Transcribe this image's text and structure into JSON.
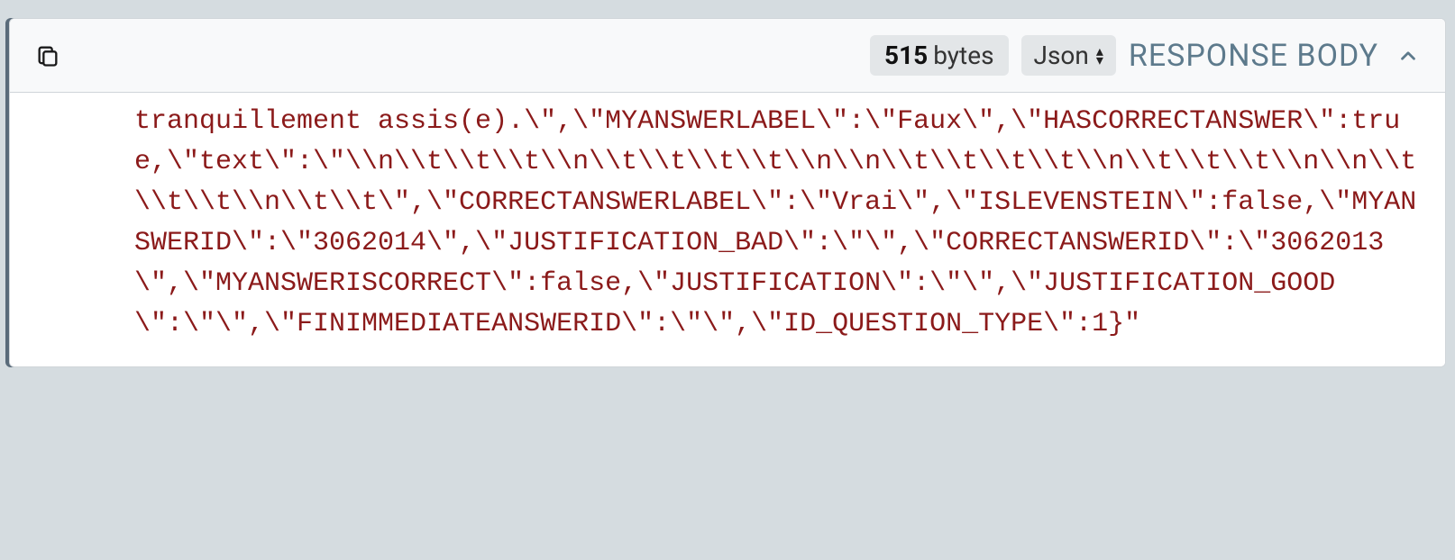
{
  "header": {
    "size_value": "515",
    "size_unit": "bytes",
    "format": "Json",
    "title": "RESPONSE BODY"
  },
  "body": {
    "text": "tranquillement assis(e).\\\",\\\"MYANSWERLABEL\\\":\\\"Faux\\\",\\\"HASCORRECTANSWER\\\":true,\\\"text\\\":\\\"\\\\n\\\\t\\\\t\\\\t\\\\n\\\\t\\\\t\\\\t\\\\t\\\\n\\\\n\\\\t\\\\t\\\\t\\\\t\\\\n\\\\t\\\\t\\\\t\\\\n\\\\n\\\\t\\\\t\\\\t\\\\n\\\\t\\\\t\\\",\\\"CORRECTANSWERLABEL\\\":\\\"Vrai\\\",\\\"ISLEVENSTEIN\\\":false,\\\"MYANSWERID\\\":\\\"3062014\\\",\\\"JUSTIFICATION_BAD\\\":\\\"\\\",\\\"CORRECTANSWERID\\\":\\\"3062013\\\",\\\"MYANSWERISCORRECT\\\":false,\\\"JUSTIFICATION\\\":\\\"\\\",\\\"JUSTIFICATION_GOOD\\\":\\\"\\\",\\\"FINIMMEDIATEANSWERID\\\":\\\"\\\",\\\"ID_QUESTION_TYPE\\\":1}\""
  }
}
